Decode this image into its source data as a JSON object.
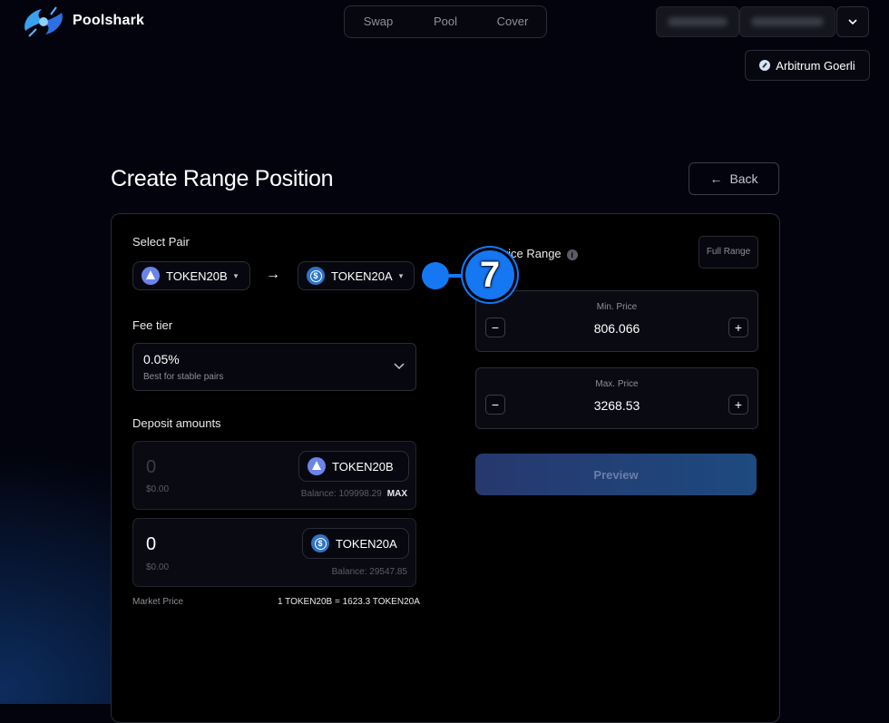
{
  "header": {
    "brand": "Poolshark",
    "nav": [
      "Swap",
      "Pool",
      "Cover"
    ],
    "network": "Arbitrum Goerli"
  },
  "page": {
    "title": "Create Range Position",
    "back_label": "Back",
    "back_arrow": "←"
  },
  "pair": {
    "label": "Select Pair",
    "token_in": "TOKEN20B",
    "token_out": "TOKEN20A",
    "arrow": "→"
  },
  "fee": {
    "label": "Fee tier",
    "value": "0.05%",
    "sub": "Best for stable pairs"
  },
  "deposit": {
    "label": "Deposit amounts",
    "rows": [
      {
        "amount": "0",
        "usd": "$0.00",
        "token": "TOKEN20B",
        "balance": "Balance: 109998.29",
        "max": "MAX"
      },
      {
        "amount": "0",
        "usd": "$0.00",
        "token": "TOKEN20A",
        "balance": "Balance: 29547.85"
      }
    ]
  },
  "market": {
    "label": "Market Price",
    "value": "1 TOKEN20B = 1623.3 TOKEN20A"
  },
  "range": {
    "label": "Set Price Range",
    "full_label": "Full Range",
    "min_label": "Min. Price",
    "min_value": "806.066",
    "max_label": "Max. Price",
    "max_value": "3268.53",
    "minus": "−",
    "plus": "+"
  },
  "preview_label": "Preview",
  "annotation": {
    "number": "7",
    "color": "#1677f2"
  }
}
